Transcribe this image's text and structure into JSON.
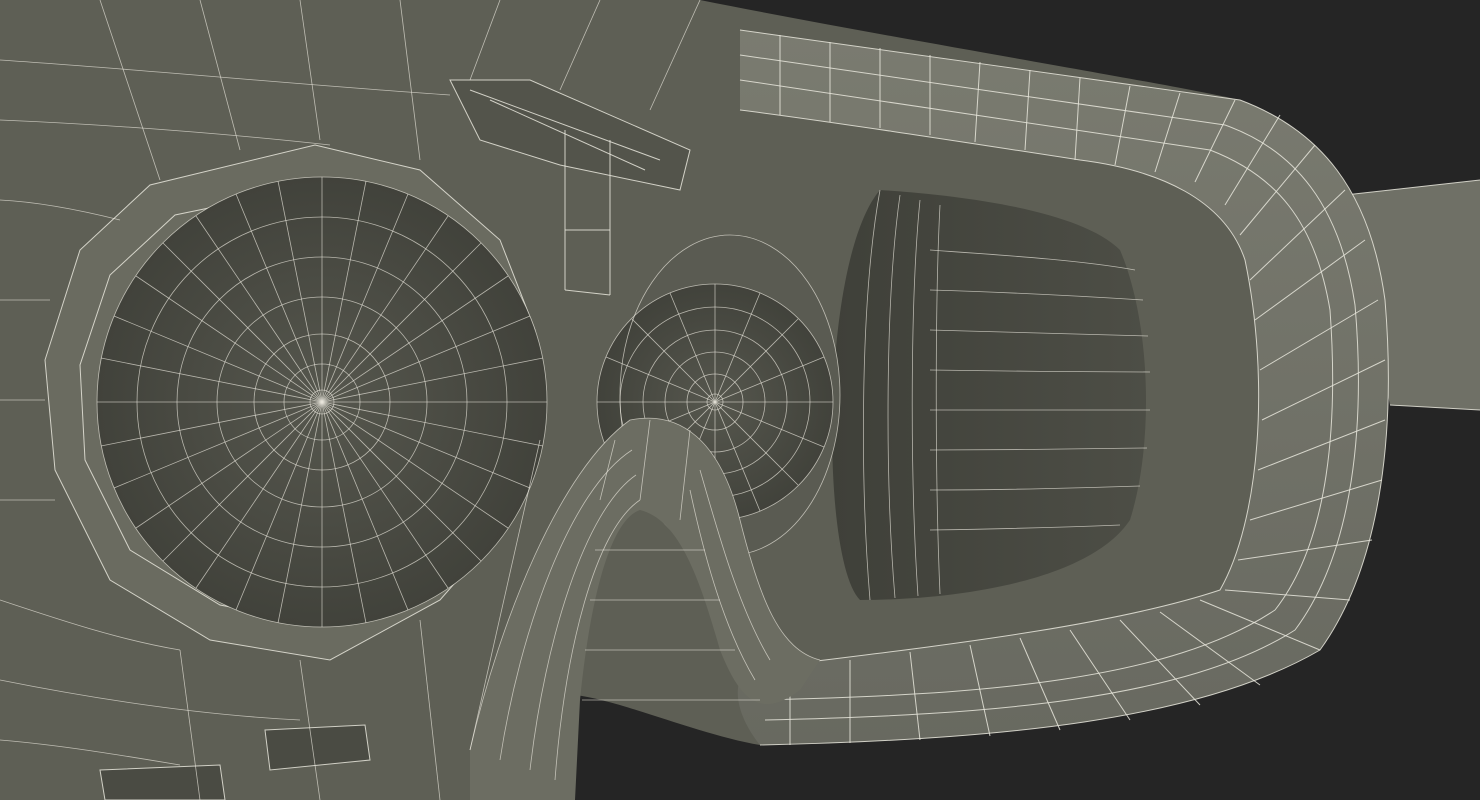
{
  "scene": {
    "background_color": "#252525",
    "surface_color": "#5e5f55",
    "surface_dark_color": "#46473f",
    "surface_light_color": "#74756a",
    "wire_color": "#e8e6dc"
  },
  "subject": "wireframe-vr-headset-interior"
}
